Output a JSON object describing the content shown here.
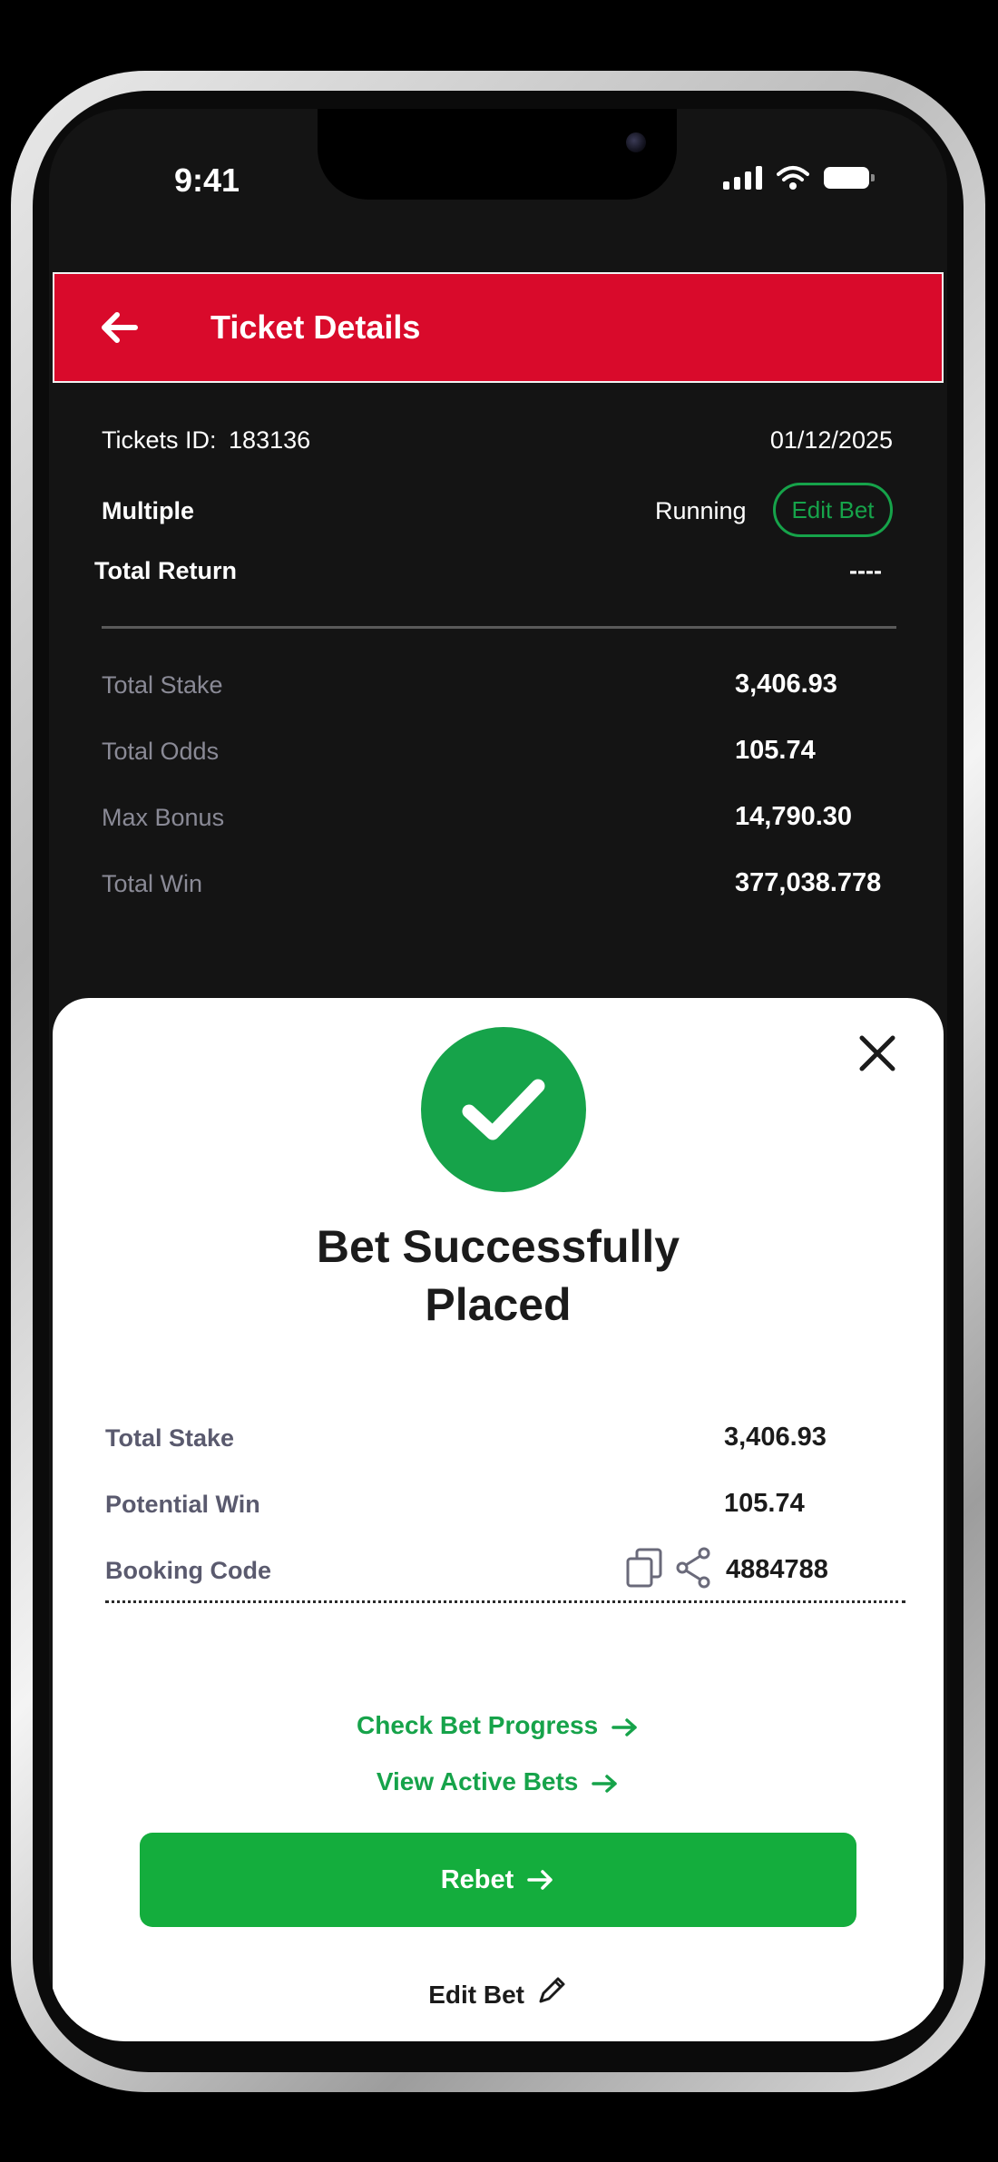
{
  "status_bar": {
    "time": "9:41"
  },
  "header": {
    "title": "Ticket Details"
  },
  "ticket": {
    "id_label": "Tickets ID:",
    "id_value": "183136",
    "date": "01/12/2025",
    "type": "Multiple",
    "status": "Running",
    "edit_bet_label": "Edit Bet",
    "total_return_label": "Total Return",
    "total_return_value": "----"
  },
  "summary": [
    {
      "label": "Total Stake",
      "value": "3,406.93"
    },
    {
      "label": "Total Odds",
      "value": "105.74"
    },
    {
      "label": "Max Bonus",
      "value": "14,790.30"
    },
    {
      "label": "Total Win",
      "value": "377,038.778"
    }
  ],
  "sheet": {
    "title_line1": "Bet Successfully",
    "title_line2": "Placed",
    "rows": [
      {
        "label": "Total Stake",
        "value": "3,406.93"
      },
      {
        "label": "Potential Win",
        "value": "105.74"
      },
      {
        "label": "Booking Code",
        "value": "4884788"
      }
    ],
    "check_progress_label": "Check Bet Progress",
    "view_active_label": "View Active Bets",
    "rebet_label": "Rebet",
    "edit_bet_label": "Edit Bet"
  },
  "colors": {
    "accent_red": "#d90a2b",
    "accent_green": "#16a34a"
  }
}
